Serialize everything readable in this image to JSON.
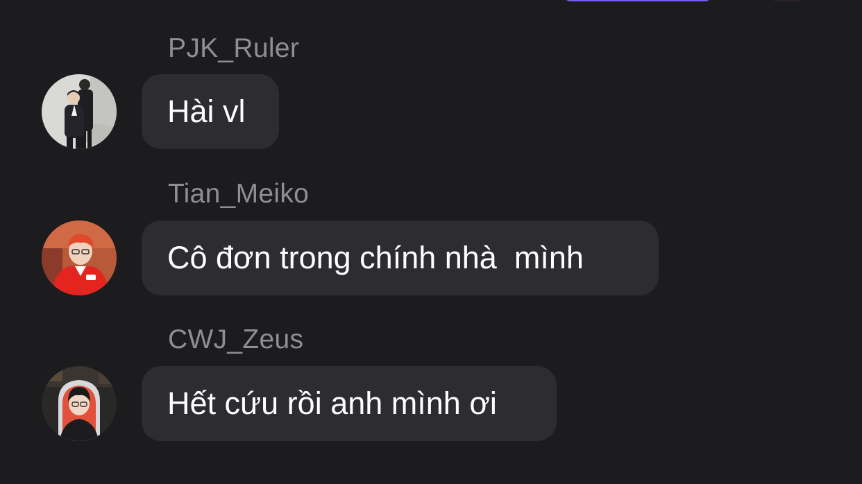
{
  "colors": {
    "background": "#1c1b1e",
    "bubble": "#2d2c31",
    "sender_name": "#8f8e96",
    "message_text": "#ffffff",
    "top_accent": "#7b5cf0"
  },
  "messages": [
    {
      "sender": "PJK_Ruler",
      "text": "Hài vl",
      "avatar_icon": "avatar-photo-two-men-suits"
    },
    {
      "sender": "Tian_Meiko",
      "text": "Cô đơn trong chính nhà  mình",
      "avatar_icon": "avatar-photo-red-jersey"
    },
    {
      "sender": "CWJ_Zeus",
      "text": "Hết cứu rồi anh mình ơi",
      "avatar_icon": "avatar-photo-gaming-chair"
    }
  ]
}
